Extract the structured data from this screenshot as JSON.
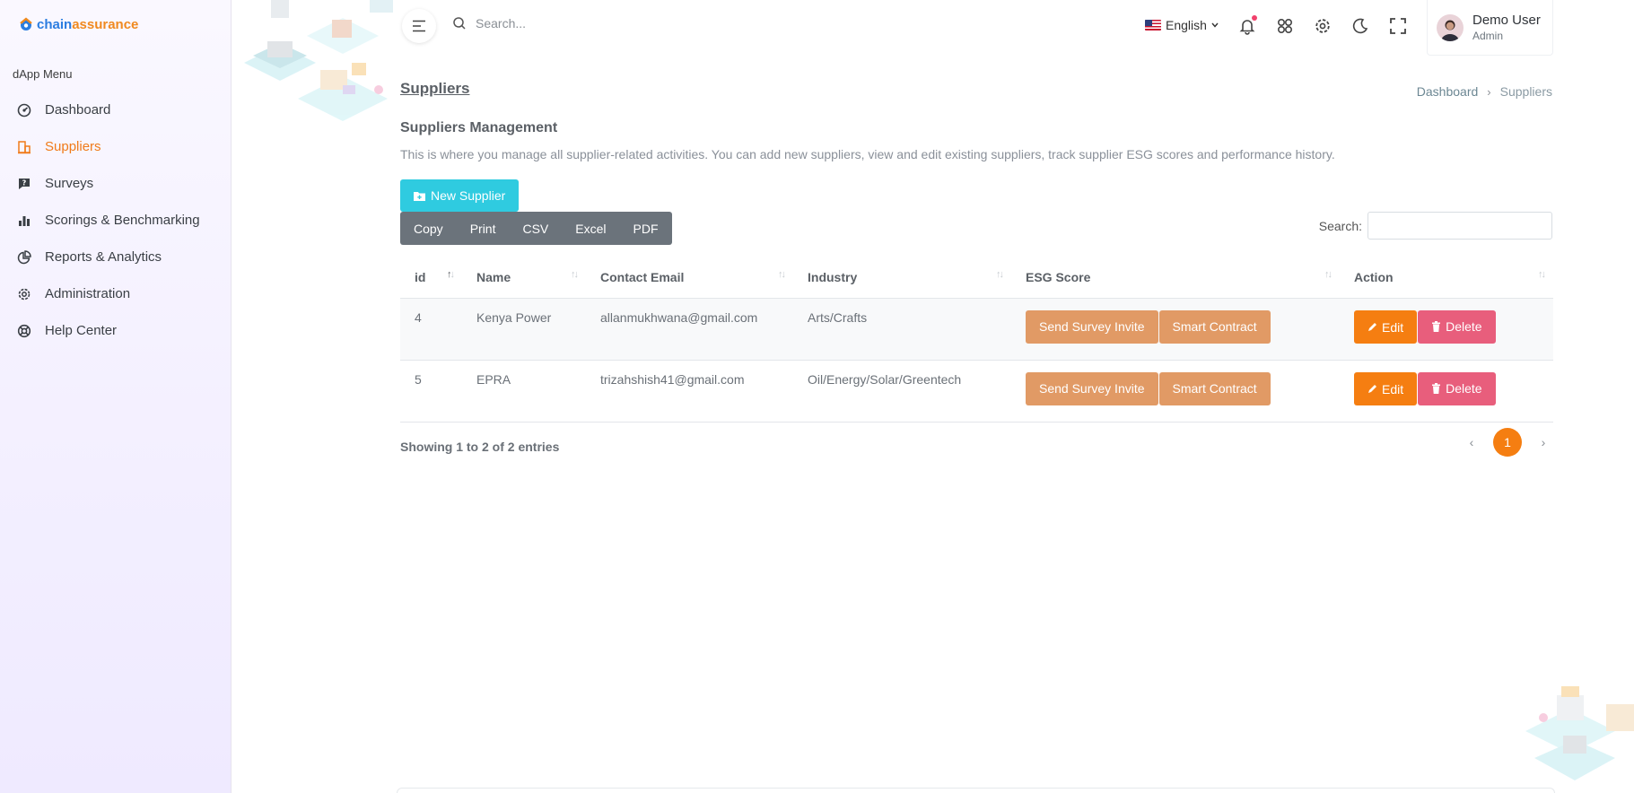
{
  "brand": {
    "part1": "chain",
    "part2": "assurance"
  },
  "sidebar": {
    "menu_title": "dApp Menu",
    "items": [
      {
        "label": "Dashboard",
        "icon": "dashboard-icon"
      },
      {
        "label": "Suppliers",
        "icon": "building-icon",
        "active": true
      },
      {
        "label": "Surveys",
        "icon": "question-chat-icon"
      },
      {
        "label": "Scorings & Benchmarking",
        "icon": "bar-chart-icon"
      },
      {
        "label": "Reports & Analytics",
        "icon": "pie-chart-icon"
      },
      {
        "label": "Administration",
        "icon": "gear-icon"
      },
      {
        "label": "Help Center",
        "icon": "lifebuoy-icon"
      }
    ]
  },
  "header": {
    "search_placeholder": "Search...",
    "language": "English",
    "user": {
      "name": "Demo User",
      "role": "Admin"
    }
  },
  "page": {
    "title": "Suppliers",
    "breadcrumb": {
      "root": "Dashboard",
      "current": "Suppliers"
    },
    "section_title": "Suppliers Management",
    "description": "This is where you manage all supplier-related activities. You can add new suppliers, view and edit existing suppliers, track supplier ESG scores and performance history.",
    "new_button": "New Supplier"
  },
  "table": {
    "export_buttons": [
      "Copy",
      "Print",
      "CSV",
      "Excel",
      "PDF"
    ],
    "search_label": "Search:",
    "columns": [
      "id",
      "Name",
      "Contact Email",
      "Industry",
      "ESG Score",
      "Action"
    ],
    "rows": [
      {
        "id": "4",
        "name": "Kenya Power",
        "email": "allanmukhwana@gmail.com",
        "industry": "Arts/Crafts"
      },
      {
        "id": "5",
        "name": "EPRA",
        "email": "trizahshish41@gmail.com",
        "industry": "Oil/Energy/Solar/Greentech"
      }
    ],
    "row_buttons": {
      "survey": "Send Survey Invite",
      "contract": "Smart Contract",
      "edit": "Edit",
      "delete": "Delete"
    },
    "showing": "Showing 1 to 2 of 2 entries",
    "pagination": {
      "current": "1",
      "prev": "‹",
      "next": "›"
    }
  },
  "colors": {
    "accent": "#f57e11",
    "new_button": "#2fcbe0",
    "survey_button": "#e19a65",
    "delete_button": "#e85e7c",
    "export_group": "#6b737b"
  }
}
